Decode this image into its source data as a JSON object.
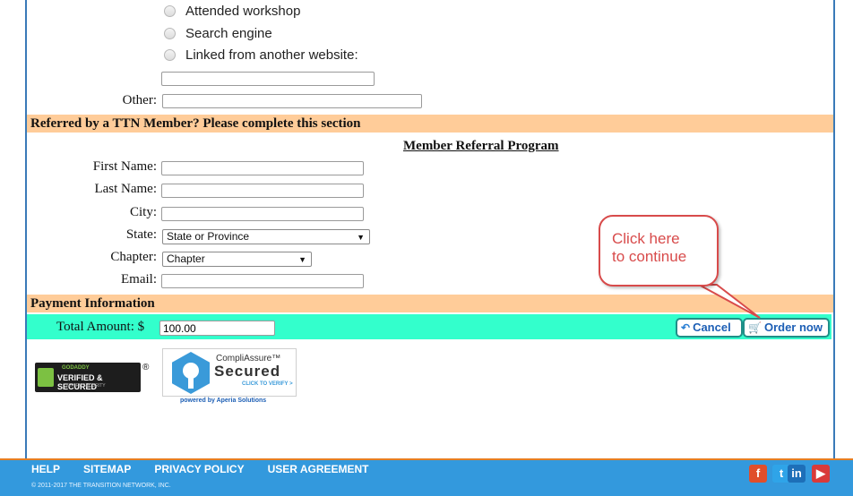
{
  "referral_source": {
    "options": [
      "Attended workshop",
      "Search engine",
      "Linked from another website:"
    ],
    "other_label": "Other:"
  },
  "member_section": {
    "band_title": "Referred by a TTN Member? Please complete this section",
    "subtitle": "Member Referral Program",
    "fields": {
      "first_name": "First Name:",
      "last_name": "Last Name:",
      "city": "City:",
      "state": "State:",
      "chapter": "Chapter:",
      "email": "Email:"
    },
    "state_select": "State or Province",
    "chapter_select": "Chapter"
  },
  "payment": {
    "band_title": "Payment Information",
    "total_label": "Total Amount: $",
    "total_value": "100.00",
    "cancel_label": "Cancel",
    "order_label": "Order now"
  },
  "callout": {
    "line1": "Click here",
    "line2": "to continue"
  },
  "badges": {
    "godaddy_top": "GODADDY",
    "godaddy_main": "VERIFIED & SECURED",
    "godaddy_sub": "VERIFY SECURITY",
    "compli_top": "CompliAssure™",
    "compli_main": "Secured",
    "compli_cta": "CLICK TO VERIFY >",
    "powered_by": "powered by Aperia Solutions"
  },
  "footer": {
    "links": [
      "HELP",
      "SITEMAP",
      "PRIVACY POLICY",
      "USER AGREEMENT"
    ],
    "copyright": "© 2011-2017 THE TRANSITION NETWORK, INC.",
    "social": [
      {
        "icon": "facebook-icon",
        "glyph": "f",
        "color": "#e04e2b"
      },
      {
        "icon": "twitter-icon",
        "glyph": "t",
        "color": "#2fa4e8"
      },
      {
        "icon": "linkedin-icon",
        "glyph": "in",
        "color": "#1d6fb8"
      },
      {
        "icon": "youtube-icon",
        "glyph": "▶",
        "color": "#d93a3a"
      }
    ]
  }
}
